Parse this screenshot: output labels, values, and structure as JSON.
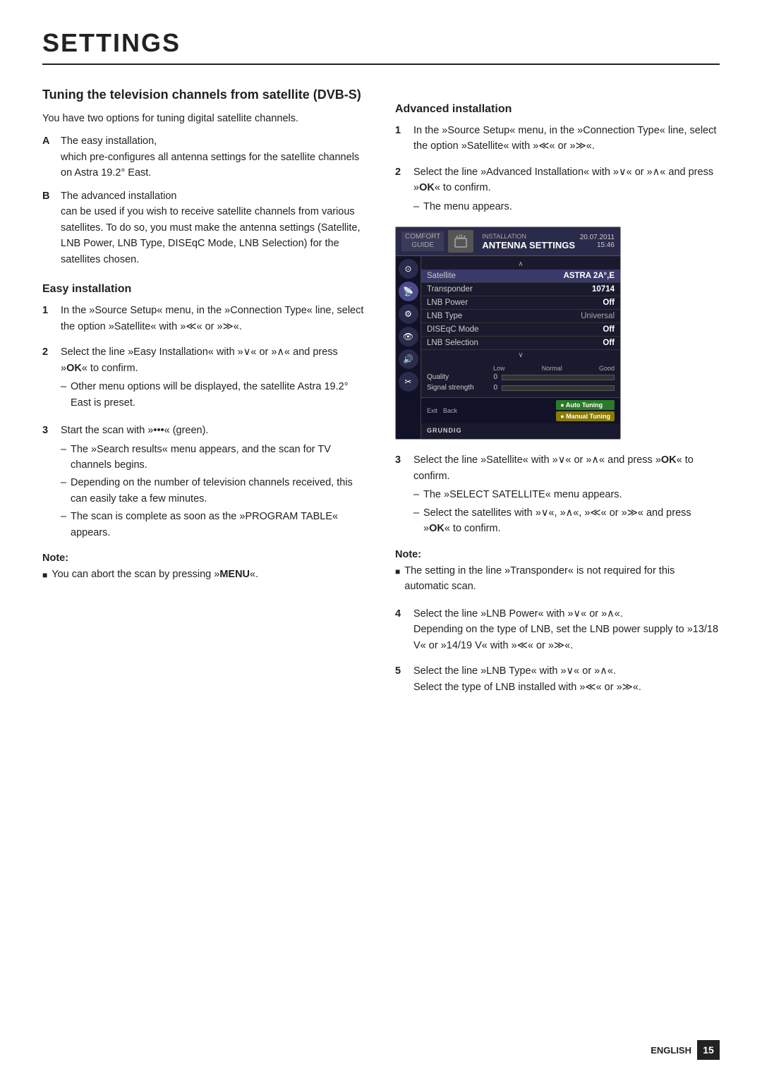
{
  "page": {
    "title": "SETTINGS",
    "footer_lang": "ENGLISH",
    "footer_page": "15"
  },
  "left_column": {
    "main_heading": "Tuning the television channels from satellite (DVB-S)",
    "intro": "You have two options for tuning digital satellite channels.",
    "options": [
      {
        "label": "A",
        "text": "The easy installation,",
        "subtext": "which pre-configures all antenna settings for the satellite channels on Astra 19.2° East."
      },
      {
        "label": "B",
        "text": "The advanced installation",
        "subtext": "can be used if you wish to receive satellite channels from various satellites. To do so, you must make the antenna settings (Satellite, LNB Power, LNB Type, DISEqC Mode, LNB Selection) for the satellites chosen."
      }
    ],
    "easy_installation": {
      "heading": "Easy installation",
      "steps": [
        {
          "num": "1",
          "text": "In the »Source Setup« menu, in the »Connection Type« line, select the option »Satellite« with »≪« or »≫«."
        },
        {
          "num": "2",
          "text": "Select the line »Easy Installation« with »∨« or »∧« and press »OK« to confirm.",
          "bullets": [
            "Other menu options will be displayed, the satellite Astra 19.2° East is preset."
          ]
        },
        {
          "num": "3",
          "text": "Start the scan with »•••« (green).",
          "bullets": [
            "The »Search results« menu appears, and the scan for TV channels begins.",
            "Depending on the number of television channels received, this can easily take a few minutes.",
            "The scan is complete as soon as the »PROGRAM TABLE« appears."
          ]
        }
      ],
      "note": {
        "label": "Note:",
        "items": [
          "You can abort the scan by pressing »MENU«."
        ]
      }
    }
  },
  "right_column": {
    "advanced_installation": {
      "heading": "Advanced installation",
      "steps": [
        {
          "num": "1",
          "text": "In the »Source Setup« menu, in the »Connection Type« line, select the option »Satellite« with »≪« or »≫«."
        },
        {
          "num": "2",
          "text": "Select the line »Advanced Installation« with »∨« or »∧« and press »OK« to confirm.",
          "bullets": [
            "The menu appears."
          ]
        }
      ],
      "tv_screenshot": {
        "guide_label": "COMFORT\nGUIDE",
        "installation_label": "INSTALLATION",
        "main_title": "ANTENNA SETTINGS",
        "date": "20.07.2011",
        "time": "15:46",
        "rows": [
          {
            "label": "Satellite",
            "value": "ASTRA 2A°,E",
            "highlighted": true
          },
          {
            "label": "Transponder",
            "value": "10714",
            "highlighted": false
          },
          {
            "label": "LNB Power",
            "value": "Off",
            "highlighted": false
          },
          {
            "label": "LNB Type",
            "value": "Universal",
            "highlighted": false
          },
          {
            "label": "DISEqC Mode",
            "value": "Off",
            "highlighted": false
          },
          {
            "label": "LNB Selection",
            "value": "Off",
            "highlighted": false
          }
        ],
        "signal": {
          "quality_label": "Quality",
          "quality_val": "0",
          "strength_label": "Signal strength",
          "strength_val": "0",
          "scale": [
            "Low",
            "Normal",
            "Good"
          ]
        },
        "footer_left": [
          "Exit",
          "Back"
        ],
        "buttons": [
          "Auto Tuning",
          "Manual Tuning"
        ],
        "logo": "GRUNDIG"
      },
      "steps2": [
        {
          "num": "3",
          "text": "Select the line »Satellite« with »∨« or »∧« and press »OK« to confirm.",
          "bullets": [
            "The »SELECT SATELLITE« menu appears.",
            "Select the satellites with »∨«, »∧«, »≪« or »≫« and press »OK« to confirm."
          ]
        }
      ],
      "note": {
        "label": "Note:",
        "items": [
          "The setting in the line »Transponder« is not required for this automatic scan."
        ]
      },
      "steps3": [
        {
          "num": "4",
          "text": "Select the line »LNB Power« with »∨« or »∧«.",
          "subtext": "Depending on the type of LNB, set the LNB power supply to »13/18 V« or »14/19 V« with »≪« or »≫«."
        },
        {
          "num": "5",
          "text": "Select the line »LNB Type« with »∨« or »∧«.",
          "subtext": "Select the type of LNB installed with »≪« or »≫«."
        }
      ]
    }
  }
}
